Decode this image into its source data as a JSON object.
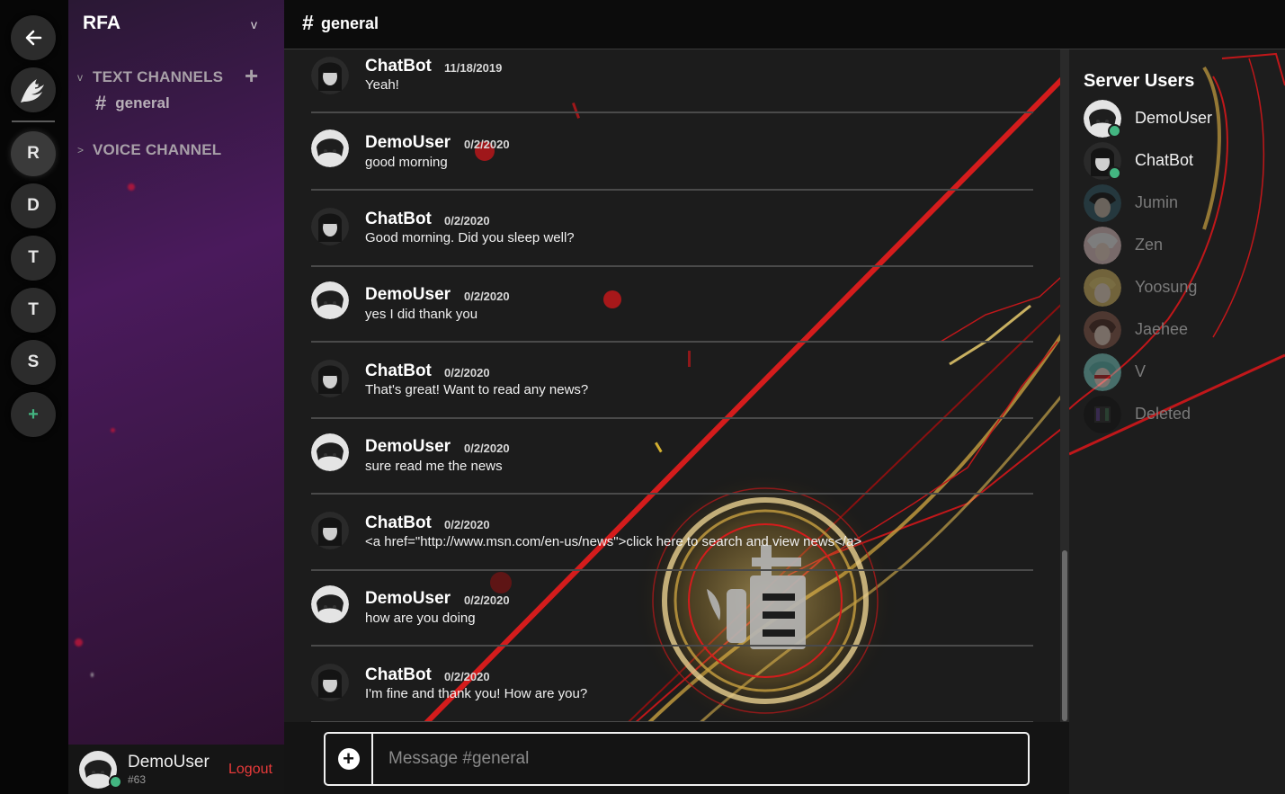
{
  "rail": {
    "back_icon": "arrow-left-icon",
    "logo_icon": "fairy-tail-logo-icon",
    "servers": [
      {
        "label": "R",
        "active": true
      },
      {
        "label": "D",
        "active": false
      },
      {
        "label": "T",
        "active": false
      },
      {
        "label": "T",
        "active": false
      },
      {
        "label": "S",
        "active": false
      }
    ],
    "add_label": "+"
  },
  "sidebar": {
    "server_name": "RFA",
    "server_chevron": "v",
    "text_category_arrow": "v",
    "text_category": "TEXT CHANNELS",
    "add_channel": "+",
    "channel_hash": "#",
    "channel_name": "general",
    "voice_category_arrow": ">",
    "voice_category": "VOICE CHANNEL"
  },
  "user_panel": {
    "name": "DemoUser",
    "tag": "#63",
    "logout": "Logout"
  },
  "header": {
    "hash": "#",
    "channel": "general"
  },
  "messages": [
    {
      "author": "ChatBot",
      "timestamp": "11/18/2019",
      "text": "Yeah!",
      "avatar": "chatbot"
    },
    {
      "author": "DemoUser",
      "timestamp": "0/2/2020",
      "text": "good morning",
      "avatar": "demouser"
    },
    {
      "author": "ChatBot",
      "timestamp": "0/2/2020",
      "text": "Good morning. Did you sleep well?",
      "avatar": "chatbot"
    },
    {
      "author": "DemoUser",
      "timestamp": "0/2/2020",
      "text": "yes I did thank you",
      "avatar": "demouser"
    },
    {
      "author": "ChatBot",
      "timestamp": "0/2/2020",
      "text": "That's great! Want to read any news?",
      "avatar": "chatbot"
    },
    {
      "author": "DemoUser",
      "timestamp": "0/2/2020",
      "text": "sure read me the news",
      "avatar": "demouser"
    },
    {
      "author": "ChatBot",
      "timestamp": "0/2/2020",
      "text": "<a href=\"http://www.msn.com/en-us/news\">click here to search and view news</a>",
      "avatar": "chatbot"
    },
    {
      "author": "DemoUser",
      "timestamp": "0/2/2020",
      "text": "how are you doing",
      "avatar": "demouser"
    },
    {
      "author": "ChatBot",
      "timestamp": "0/2/2020",
      "text": "I'm fine and thank you! How are you?",
      "avatar": "chatbot"
    }
  ],
  "composer": {
    "placeholder": "Message #general",
    "attach_icon": "plus-circle-icon"
  },
  "members": {
    "title": "Server Users",
    "list": [
      {
        "name": "DemoUser",
        "online": true,
        "color": "#d8d8d8"
      },
      {
        "name": "ChatBot",
        "online": true,
        "color": "#555555"
      },
      {
        "name": "Jumin",
        "online": false,
        "color": "#2f5a66"
      },
      {
        "name": "Zen",
        "online": false,
        "color": "#e8c8c8"
      },
      {
        "name": "Yoosung",
        "online": false,
        "color": "#d8b860"
      },
      {
        "name": "Jaehee",
        "online": false,
        "color": "#8a5a4a"
      },
      {
        "name": "V",
        "online": false,
        "color": "#7ad0c8"
      },
      {
        "name": "Deleted",
        "online": false,
        "color": "#222222"
      }
    ]
  },
  "colors": {
    "accent_red": "#e12a2a",
    "online_green": "#43b581",
    "logout_red": "#e83a3a",
    "emblem_gold": "#d4a83a"
  }
}
